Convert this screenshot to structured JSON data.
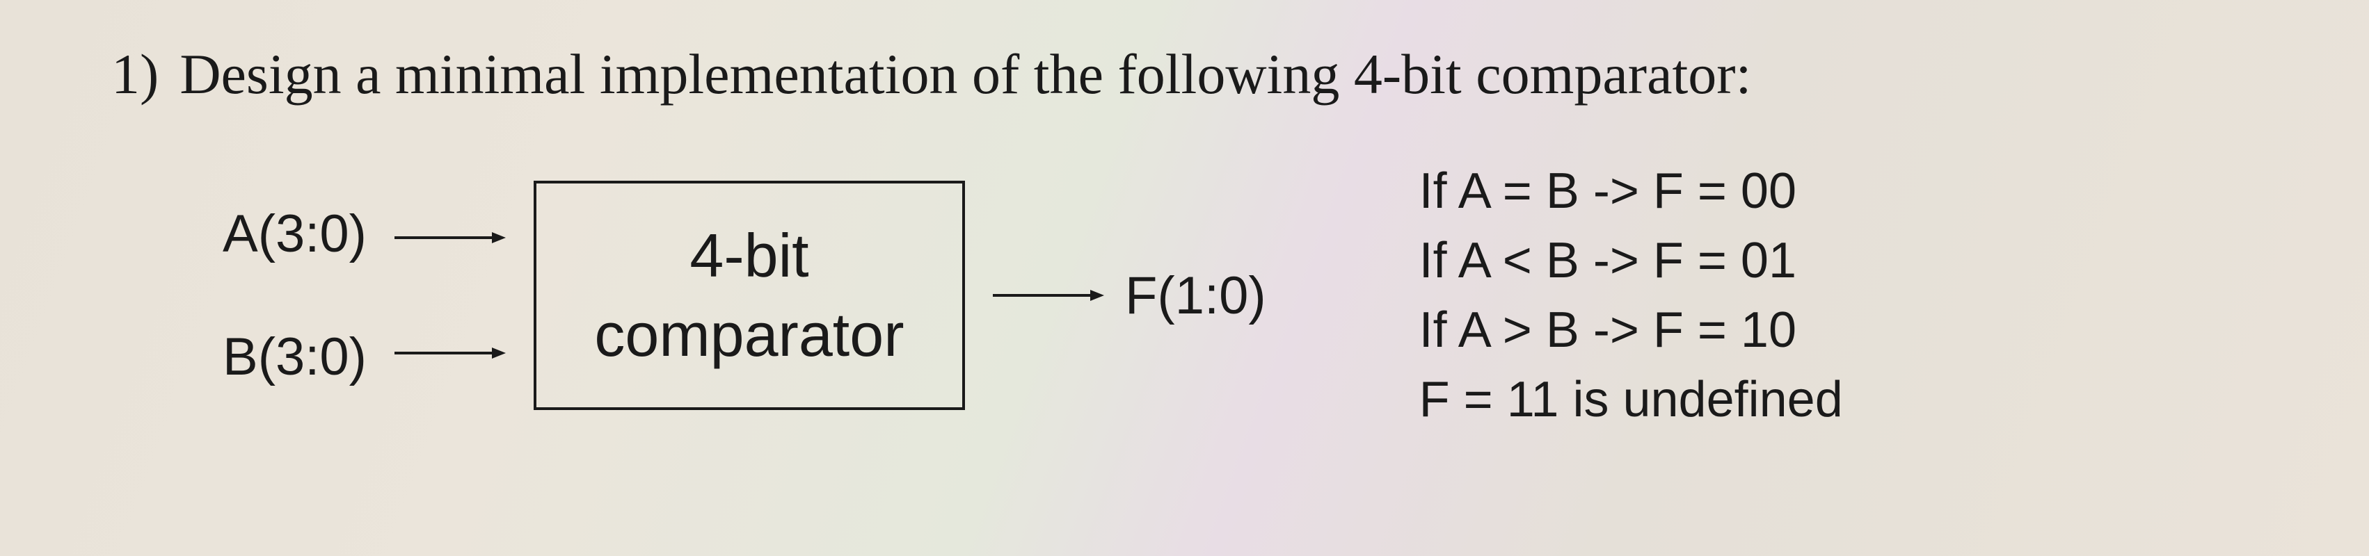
{
  "question": {
    "number": "1)",
    "text": "Design a minimal implementation of the following 4-bit comparator:"
  },
  "diagram": {
    "inputs": {
      "a": "A(3:0)",
      "b": "B(3:0)"
    },
    "box": {
      "line1": "4-bit",
      "line2": "comparator"
    },
    "output": "F(1:0)"
  },
  "conditions": {
    "eq": "If A = B -> F = 00",
    "lt": "If A < B -> F = 01",
    "gt": "If A > B -> F = 10",
    "undef": "F = 11 is undefined"
  }
}
